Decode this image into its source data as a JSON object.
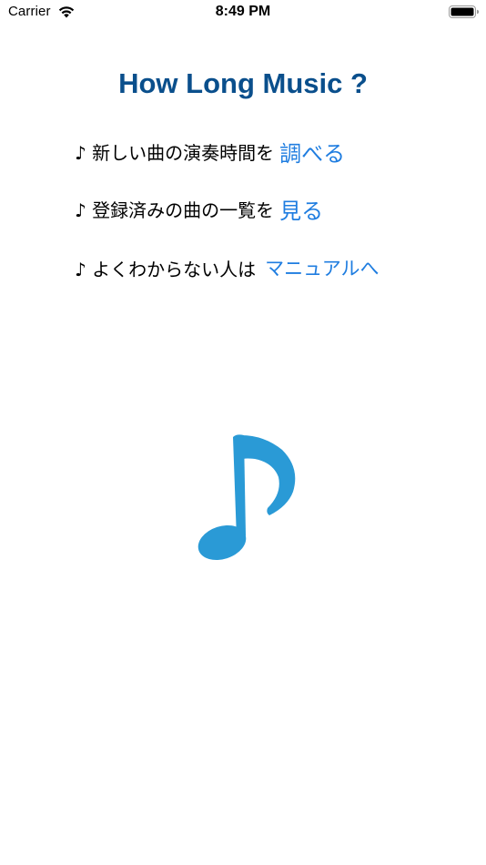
{
  "status_bar": {
    "carrier": "Carrier",
    "time": "8:49 PM",
    "wifi_icon": "wifi-icon",
    "battery_icon": "battery-icon"
  },
  "title": "How Long Music ?",
  "menu": [
    {
      "text": "♪ 新しい曲の演奏時間を",
      "link": "調べる"
    },
    {
      "text": "♪ 登録済みの曲の一覧を",
      "link": "見る"
    },
    {
      "text": "♪ よくわからない人は",
      "link": "マニュアルへ"
    }
  ],
  "illustration": {
    "icon": "music-note-icon",
    "color": "#2a9ad6"
  },
  "colors": {
    "title": "#0a4f8c",
    "link": "#1f7de0"
  }
}
